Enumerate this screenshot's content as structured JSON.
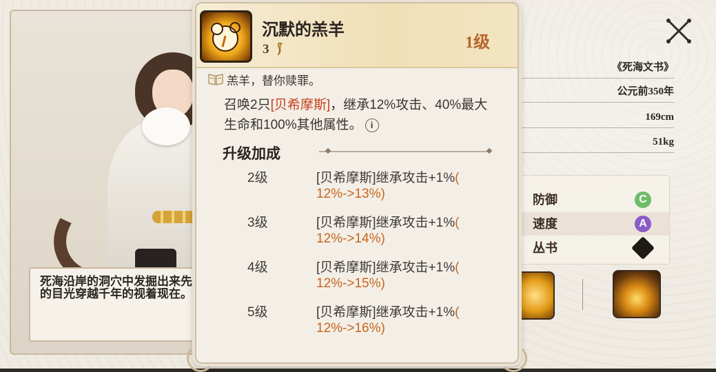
{
  "character": {
    "description": "死海沿岸的洞穴中发掘出来先知的目光穿越千年的视着现在。"
  },
  "info_rows": [
    {
      "value": "《死海文书》"
    },
    {
      "value": "公元前350年"
    },
    {
      "value": "169cm"
    },
    {
      "value": "51kg"
    }
  ],
  "stats": [
    {
      "label": "防御",
      "grade": "C",
      "color": "#6ebc6a"
    },
    {
      "label": "速度",
      "grade": "A",
      "color": "#8a5cc7"
    },
    {
      "label": "丛书",
      "grade": "",
      "icon": "series-emblem-icon"
    }
  ],
  "popup": {
    "skill_name": "沉默的羔羊",
    "cost": "3",
    "level": "1级",
    "flavor": "羔羊，替你赎罪。",
    "effect_pre": "召唤2只",
    "effect_highlight": "[贝希摩斯]",
    "effect_post": "，继承12%攻击、40%最大生命和100%其他属性。",
    "info_glyph": "i",
    "upgrade_title": "升级加成",
    "upgrades": [
      {
        "level": "2级",
        "text": "[贝希摩斯]继承攻击+1%",
        "paren": "(",
        "change": "12%->13%)"
      },
      {
        "level": "3级",
        "text": "[贝希摩斯]继承攻击+1%",
        "paren": "(",
        "change": "12%->14%)"
      },
      {
        "level": "4级",
        "text": "[贝希摩斯]继承攻击+1%",
        "paren": "(",
        "change": "12%->15%)"
      },
      {
        "level": "5级",
        "text": "[贝希摩斯]继承攻击+1%",
        "paren": "(",
        "change": "12%->16%)"
      }
    ]
  },
  "colors": {
    "accent_orange": "#c8641e",
    "highlight_red": "#c8401e",
    "level_color": "#b4642a"
  }
}
